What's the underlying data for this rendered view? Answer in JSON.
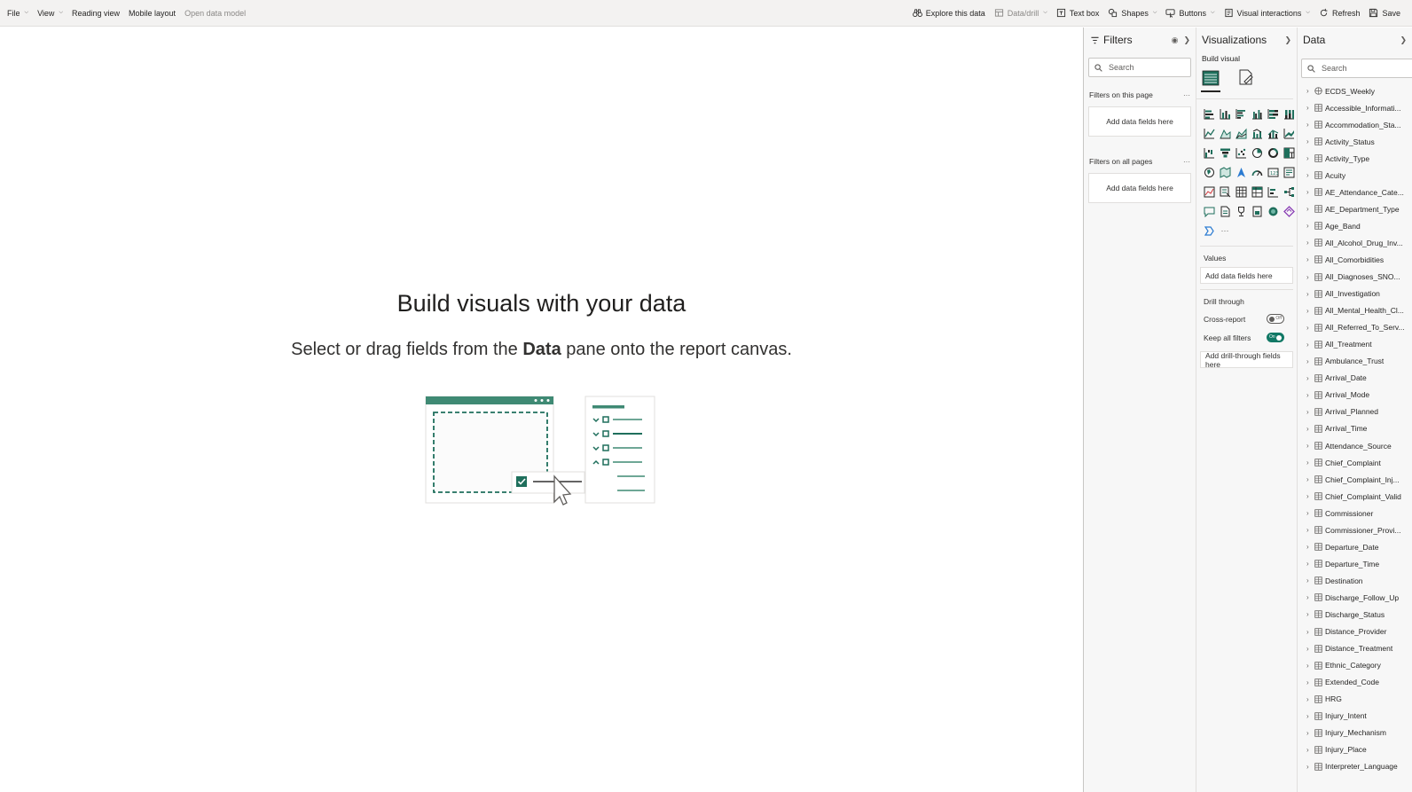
{
  "ribbon": {
    "left": [
      {
        "label": "File",
        "dropdown": true
      },
      {
        "label": "View",
        "dropdown": true
      },
      {
        "label": "Reading view",
        "dropdown": false
      },
      {
        "label": "Mobile layout",
        "dropdown": false
      },
      {
        "label": "Open data model",
        "dropdown": false,
        "disabled": true
      }
    ],
    "right": [
      {
        "label": "Explore this data",
        "icon": "binoculars-icon",
        "dropdown": false
      },
      {
        "label": "Data/drill",
        "icon": "data-drill-icon",
        "dropdown": true,
        "disabled": true
      },
      {
        "label": "Text box",
        "icon": "text-box-icon",
        "dropdown": false
      },
      {
        "label": "Shapes",
        "icon": "shapes-icon",
        "dropdown": true
      },
      {
        "label": "Buttons",
        "icon": "buttons-icon",
        "dropdown": true
      },
      {
        "label": "Visual interactions",
        "icon": "visual-interactions-icon",
        "dropdown": true
      },
      {
        "label": "Refresh",
        "icon": "refresh-icon",
        "dropdown": false
      },
      {
        "label": "Save",
        "icon": "save-icon",
        "dropdown": false
      }
    ]
  },
  "canvas": {
    "title": "Build visuals with your data",
    "subtitle_pre": "Select or drag fields from the ",
    "subtitle_bold": "Data",
    "subtitle_post": " pane onto the report canvas."
  },
  "filters": {
    "title": "Filters",
    "search_placeholder": "Search",
    "page_label": "Filters on this page",
    "page_well": "Add data fields here",
    "all_label": "Filters on all pages",
    "all_well": "Add data fields here"
  },
  "visualizations": {
    "title": "Visualizations",
    "build_label": "Build visual",
    "values_label": "Values",
    "values_well": "Add data fields here",
    "drill_label": "Drill through",
    "cross_report_label": "Cross-report",
    "cross_report_state": "Off",
    "keep_filters_label": "Keep all filters",
    "keep_filters_state": "On",
    "drill_well": "Add drill-through fields here",
    "more_label": "···"
  },
  "data": {
    "title": "Data",
    "search_placeholder": "Search",
    "tables": [
      "ECDS_Weekly",
      "Accessible_Informati...",
      "Accommodation_Sta...",
      "Activity_Status",
      "Activity_Type",
      "Acuity",
      "AE_Attendance_Cate...",
      "AE_Department_Type",
      "Age_Band",
      "All_Alcohol_Drug_Inv...",
      "All_Comorbidities",
      "All_Diagnoses_SNO...",
      "All_Investigation",
      "All_Mental_Health_Cl...",
      "All_Referred_To_Serv...",
      "All_Treatment",
      "Ambulance_Trust",
      "Arrival_Date",
      "Arrival_Mode",
      "Arrival_Planned",
      "Arrival_Time",
      "Attendance_Source",
      "Chief_Complaint",
      "Chief_Complaint_Inj...",
      "Chief_Complaint_Valid",
      "Commissioner",
      "Commissioner_Provi...",
      "Departure_Date",
      "Departure_Time",
      "Destination",
      "Discharge_Follow_Up",
      "Discharge_Status",
      "Distance_Provider",
      "Distance_Treatment",
      "Ethnic_Category",
      "Extended_Code",
      "HRG",
      "Injury_Intent",
      "Injury_Mechanism",
      "Injury_Place",
      "Interpreter_Language"
    ]
  },
  "colors": {
    "accent": "#117865",
    "ribbon_bg": "#f3f2f1",
    "pane_bg": "#f7f7f7"
  }
}
